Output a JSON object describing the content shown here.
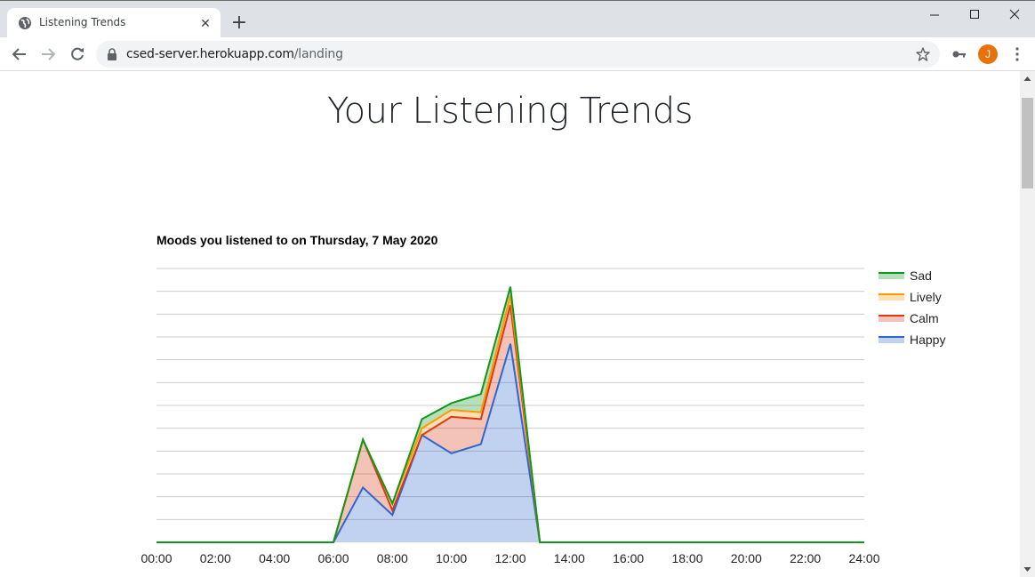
{
  "browser": {
    "tab_title": "Listening Trends",
    "tab_close_glyph": "✕",
    "new_tab_glyph": "+",
    "url_host": "csed-server.herokuapp.com",
    "url_path": "/landing",
    "avatar_initial": "J",
    "avatar_color": "#e8710a"
  },
  "page": {
    "title": "Your Listening Trends"
  },
  "chart_data": {
    "type": "area",
    "stacked": true,
    "title": "Moods you listened to on Thursday, 7 May 2020",
    "x_ticks": [
      "00:00",
      "02:00",
      "04:00",
      "06:00",
      "08:00",
      "10:00",
      "12:00",
      "14:00",
      "16:00",
      "18:00",
      "20:00",
      "22:00",
      "24:00"
    ],
    "x_hours": [
      0,
      1,
      2,
      3,
      4,
      5,
      6,
      7,
      8,
      9,
      10,
      11,
      12,
      13,
      14,
      15,
      16,
      17,
      18,
      19,
      20,
      21,
      22,
      23,
      24
    ],
    "ylim": [
      0,
      12
    ],
    "grid": true,
    "legend_position": "right",
    "series": [
      {
        "name": "Happy",
        "color": "#3366cc",
        "values": [
          0,
          0,
          0,
          0,
          0,
          0,
          0,
          2.4,
          1.2,
          4.7,
          3.9,
          4.3,
          8.7,
          0,
          0,
          0,
          0,
          0,
          0,
          0,
          0,
          0,
          0,
          0,
          0
        ]
      },
      {
        "name": "Calm",
        "color": "#dc3912",
        "values": [
          0,
          0,
          0,
          0,
          0,
          0,
          0,
          2.1,
          0.2,
          0,
          1.6,
          1.1,
          1.7,
          0,
          0,
          0,
          0,
          0,
          0,
          0,
          0,
          0,
          0,
          0,
          0
        ]
      },
      {
        "name": "Lively",
        "color": "#ff9900",
        "values": [
          0,
          0,
          0,
          0,
          0,
          0,
          0,
          0,
          0.3,
          0.3,
          0.3,
          0.3,
          0.4,
          0,
          0,
          0,
          0,
          0,
          0,
          0,
          0,
          0,
          0,
          0,
          0
        ]
      },
      {
        "name": "Sad",
        "color": "#109618",
        "values": [
          0,
          0,
          0,
          0,
          0,
          0,
          0,
          0,
          0,
          0.4,
          0.3,
          0.8,
          0.4,
          0,
          0,
          0,
          0,
          0,
          0,
          0,
          0,
          0,
          0,
          0,
          0
        ]
      }
    ],
    "legend_order": [
      "Sad",
      "Lively",
      "Calm",
      "Happy"
    ]
  }
}
